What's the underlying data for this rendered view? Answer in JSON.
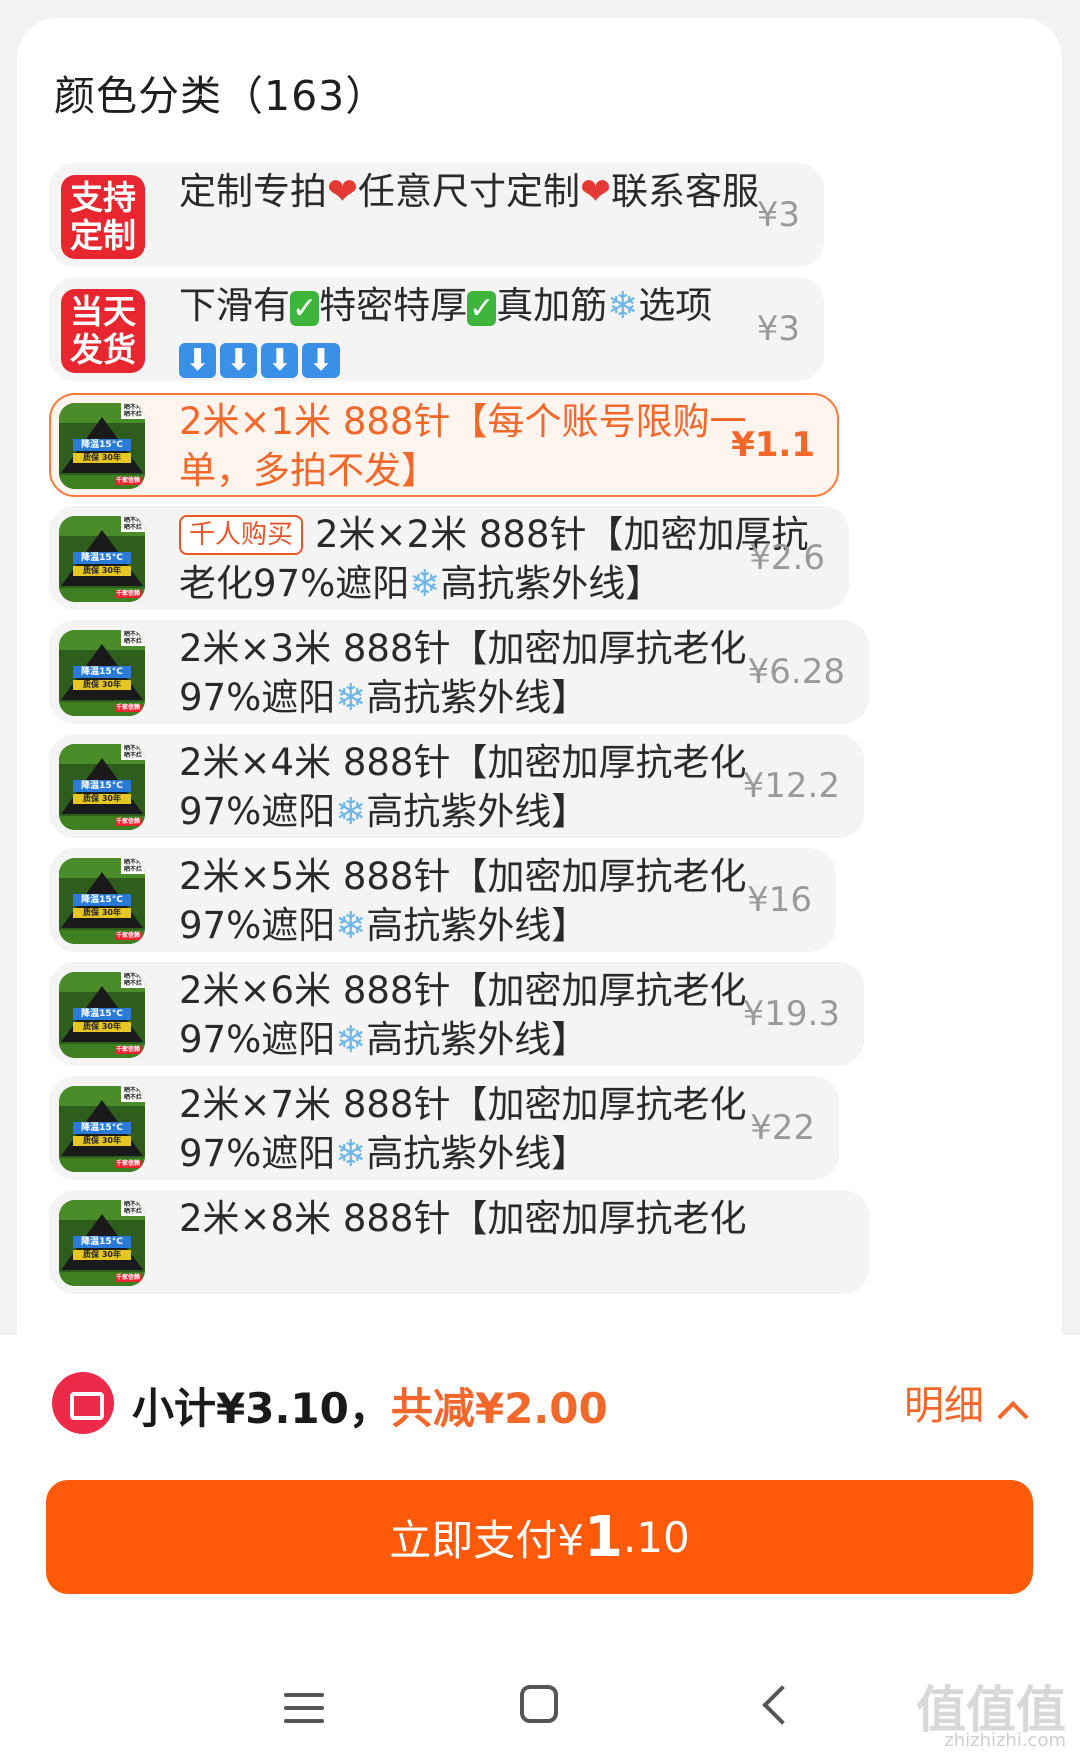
{
  "section": {
    "title": "颜色分类（163）"
  },
  "options": [
    {
      "badge": "支持\n定制",
      "segments": [
        [
          "text",
          "定制专拍"
        ],
        [
          "heart",
          "❤"
        ],
        [
          "text",
          "任意尺寸定制"
        ],
        [
          "heart",
          "❤"
        ],
        [
          "text",
          "联系客服"
        ]
      ],
      "price": "¥3",
      "selected": false
    },
    {
      "badge": "当天\n发货",
      "segments": [
        [
          "text",
          "下滑有"
        ],
        [
          "check",
          "✓"
        ],
        [
          "text",
          "特密特厚"
        ],
        [
          "check",
          "✓"
        ],
        [
          "text",
          "真加筋"
        ],
        [
          "snow",
          "❄"
        ],
        [
          "text",
          "选项"
        ],
        [
          "arrow",
          "⬇"
        ],
        [
          "arrow",
          "⬇"
        ],
        [
          "arrow",
          "⬇"
        ],
        [
          "arrow",
          "⬇"
        ]
      ],
      "price": "¥3",
      "selected": false
    },
    {
      "text": "2米×1米 888针【每个账号限购一单，多拍不发】",
      "price": "¥1.1",
      "selected": true
    },
    {
      "tag": "千人购买",
      "segments": [
        [
          "text",
          "2米×2米 888针【加密加厚抗老化97%遮阳"
        ],
        [
          "snow",
          "❄"
        ],
        [
          "text",
          "高抗紫外线】"
        ]
      ],
      "price": "¥2.6",
      "selected": false
    },
    {
      "segments": [
        [
          "text",
          "2米×3米 888针【加密加厚抗老化97%遮阳"
        ],
        [
          "snow",
          "❄"
        ],
        [
          "text",
          "高抗紫外线】"
        ]
      ],
      "price": "¥6.28",
      "selected": false
    },
    {
      "segments": [
        [
          "text",
          "2米×4米 888针【加密加厚抗老化97%遮阳"
        ],
        [
          "snow",
          "❄"
        ],
        [
          "text",
          "高抗紫外线】"
        ]
      ],
      "price": "¥12.2",
      "selected": false
    },
    {
      "segments": [
        [
          "text",
          "2米×5米 888针【加密加厚抗老化97%遮阳"
        ],
        [
          "snow",
          "❄"
        ],
        [
          "text",
          "高抗紫外线】"
        ]
      ],
      "price": "¥16",
      "selected": false
    },
    {
      "segments": [
        [
          "text",
          "2米×6米 888针【加密加厚抗老化97%遮阳"
        ],
        [
          "snow",
          "❄"
        ],
        [
          "text",
          "高抗紫外线】"
        ]
      ],
      "price": "¥19.3",
      "selected": false
    },
    {
      "segments": [
        [
          "text",
          "2米×7米 888针【加密加厚抗老化97%遮阳"
        ],
        [
          "snow",
          "❄"
        ],
        [
          "text",
          "高抗紫外线】"
        ]
      ],
      "price": "¥22",
      "selected": false
    },
    {
      "text": "2米×8米 888针【加密加厚抗老化",
      "price": "",
      "selected": false
    }
  ],
  "thumb": {
    "top_right": "晒不坏\n晒不烂",
    "band1": "降温15°C",
    "band2": "质保 30年",
    "footer": "千家信赖"
  },
  "summary": {
    "subtotal": "小计¥3.10，",
    "discount": "共减¥2.00",
    "detail": "明细"
  },
  "pay": {
    "prefix": "立即支付¥",
    "int": "1",
    "dec": ".10"
  },
  "watermark": {
    "main": "值值值",
    "sub": "zhizhizhi.com"
  },
  "colors": {
    "accent": "#ff5a0a",
    "accent_text": "#f2672a",
    "badge_red": "#e8262f"
  }
}
